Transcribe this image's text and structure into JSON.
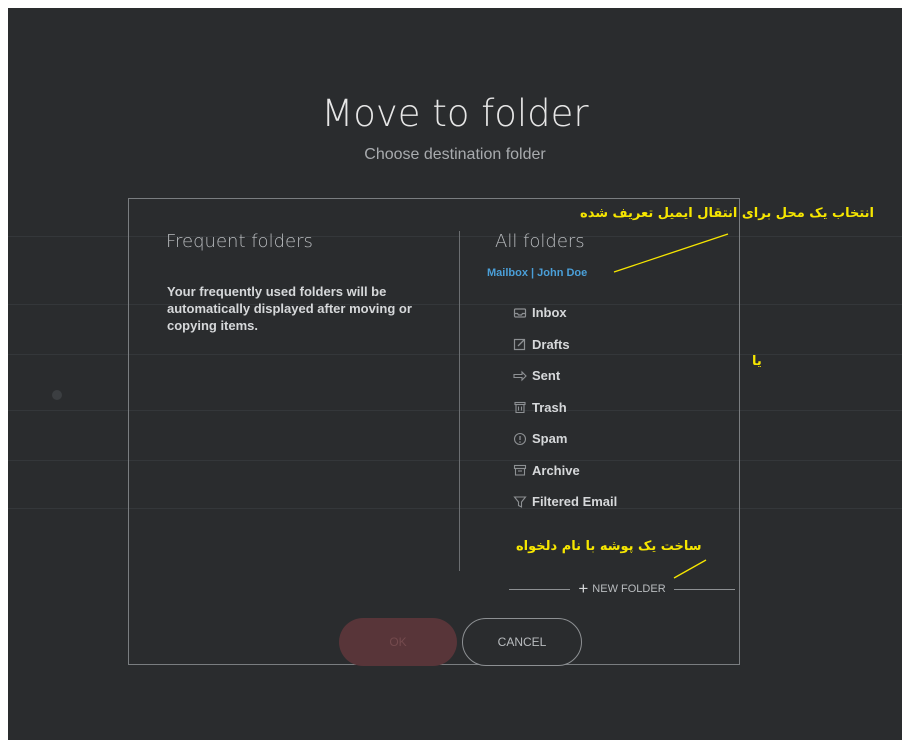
{
  "dialog": {
    "title": "Move to folder",
    "subtitle": "Choose destination folder",
    "frequent": {
      "heading": "Frequent folders",
      "description": "Your frequently used folders will be automatically displayed after moving or copying items."
    },
    "all": {
      "heading": "All folders",
      "mailbox_label": "Mailbox | John Doe",
      "folders": [
        {
          "label": "Inbox",
          "icon": "inbox-icon"
        },
        {
          "label": "Drafts",
          "icon": "drafts-icon"
        },
        {
          "label": "Sent",
          "icon": "sent-icon"
        },
        {
          "label": "Trash",
          "icon": "trash-icon"
        },
        {
          "label": "Spam",
          "icon": "spam-icon"
        },
        {
          "label": "Archive",
          "icon": "archive-icon"
        },
        {
          "label": "Filtered Email",
          "icon": "filter-icon"
        }
      ],
      "new_folder_label": "NEW FOLDER"
    },
    "ok_label": "OK",
    "cancel_label": "CANCEL"
  },
  "annotations": {
    "select_location": "انتخاب یک محل برای انتقال ایمیل تعریف شده",
    "or": "یا",
    "create_folder": "ساخت یک پوشه با نام دلخواه"
  },
  "colors": {
    "overlay_bg": "#2a2c2e",
    "accent_link": "#4a9fd8",
    "ok_button": "#583539",
    "annotation": "#f6e600"
  }
}
